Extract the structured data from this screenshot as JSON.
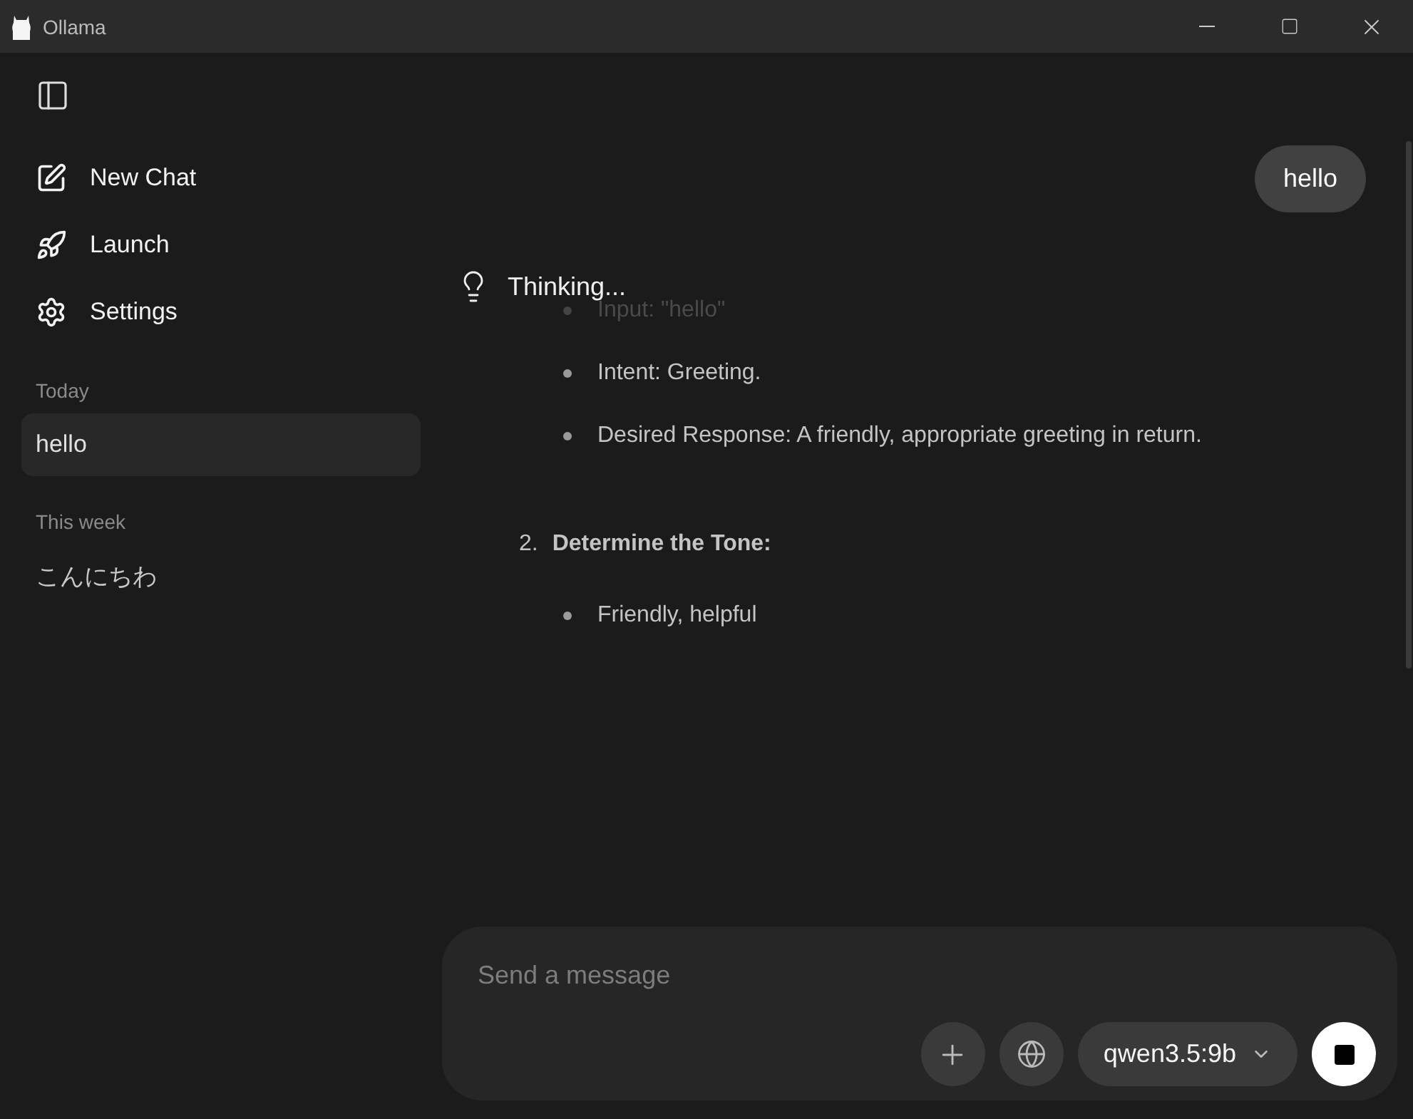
{
  "window": {
    "title": "Ollama"
  },
  "sidebar": {
    "actions": [
      {
        "kind": "new",
        "label": "New Chat"
      },
      {
        "kind": "launch",
        "label": "Launch"
      },
      {
        "kind": "settings",
        "label": "Settings"
      }
    ],
    "groups": [
      {
        "heading": "Today",
        "chats": [
          {
            "title": "hello",
            "selected": true
          }
        ]
      },
      {
        "heading": "This week",
        "chats": [
          {
            "title": "こんにちわ",
            "selected": false
          }
        ]
      }
    ]
  },
  "conversation": {
    "user_message": "hello",
    "thinking": {
      "label": "Thinking...",
      "blocks": [
        {
          "kind": "bullets",
          "items": [
            {
              "text": "Input: \"hello\"",
              "faded": true
            },
            {
              "text": "Intent: Greeting.",
              "faded": false
            },
            {
              "text": "Desired Response: A friendly, appropriate greeting in return.",
              "faded": false
            }
          ]
        },
        {
          "kind": "step",
          "number": "2.",
          "title": "Determine the Tone:"
        },
        {
          "kind": "bullets",
          "items": [
            {
              "text": "Friendly, helpful",
              "faded": false
            }
          ]
        }
      ]
    }
  },
  "composer": {
    "placeholder": "Send a message",
    "model": "qwen3.5:9b"
  }
}
